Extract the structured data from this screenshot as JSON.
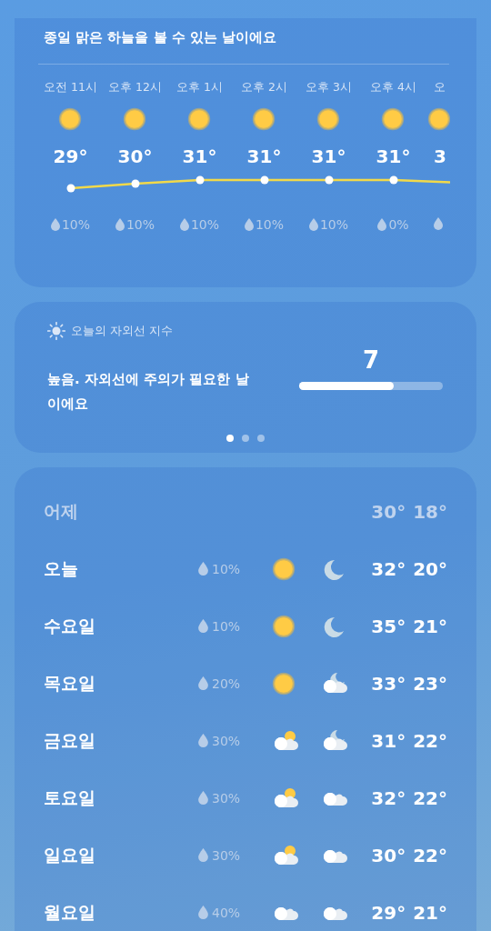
{
  "hourly_card": {
    "summary": "종일 맑은 하늘을 볼 수 있는 날이에요",
    "hours": [
      {
        "time": "오전 11시",
        "temp": "29°",
        "precip": "10%"
      },
      {
        "time": "오후 12시",
        "temp": "30°",
        "precip": "10%"
      },
      {
        "time": "오후 1시",
        "temp": "31°",
        "precip": "10%"
      },
      {
        "time": "오후 2시",
        "temp": "31°",
        "precip": "10%"
      },
      {
        "time": "오후 3시",
        "temp": "31°",
        "precip": "10%"
      },
      {
        "time": "오후 4시",
        "temp": "31°",
        "precip": "0%"
      },
      {
        "time": "오",
        "temp": "3"
      }
    ]
  },
  "uv_card": {
    "title": "오늘의 자외선 지수",
    "description": "높음. 자외선에 주의가 필요한 날이에요",
    "value": "7",
    "level": 0.66,
    "pages": [
      {
        "selected": true
      },
      {
        "selected": false
      },
      {
        "selected": false
      }
    ]
  },
  "daily_card": {
    "rows": [
      {
        "kind": "past",
        "day": "어제",
        "high": "30°",
        "low": "18°"
      },
      {
        "kind": "forecast",
        "day": "오늘",
        "precip": "10%",
        "day_weather": {
          "kind": "sun"
        },
        "night_weather": {
          "kind": "moon"
        },
        "high": "32°",
        "low": "20°"
      },
      {
        "kind": "forecast",
        "day": "수요일",
        "precip": "10%",
        "day_weather": {
          "kind": "sun"
        },
        "night_weather": {
          "kind": "moon"
        },
        "high": "35°",
        "low": "21°"
      },
      {
        "kind": "forecast",
        "day": "목요일",
        "precip": "20%",
        "day_weather": {
          "kind": "sun"
        },
        "night_weather": {
          "kind": "cloudmoon"
        },
        "high": "33°",
        "low": "23°"
      },
      {
        "kind": "forecast",
        "day": "금요일",
        "precip": "30%",
        "day_weather": {
          "kind": "cloudsun"
        },
        "night_weather": {
          "kind": "cloudmoon"
        },
        "high": "31°",
        "low": "22°"
      },
      {
        "kind": "forecast",
        "day": "토요일",
        "precip": "30%",
        "day_weather": {
          "kind": "cloudsun"
        },
        "night_weather": {
          "kind": "cloud"
        },
        "high": "32°",
        "low": "22°"
      },
      {
        "kind": "forecast",
        "day": "일요일",
        "precip": "30%",
        "day_weather": {
          "kind": "cloudsun"
        },
        "night_weather": {
          "kind": "cloud"
        },
        "high": "30°",
        "low": "22°"
      },
      {
        "kind": "forecast",
        "day": "월요일",
        "precip": "40%",
        "day_weather": {
          "kind": "cloud"
        },
        "night_weather": {
          "kind": "cloud"
        },
        "high": "29°",
        "low": "21°"
      }
    ]
  }
}
